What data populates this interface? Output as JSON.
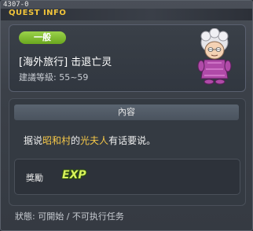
{
  "window": {
    "quest_id": "4307-0",
    "title": "QUEST INFO"
  },
  "quest": {
    "category_badge": "一般",
    "name": "[海外旅行] 击退亡灵",
    "level_requirement": "建議等級: 55~59"
  },
  "content": {
    "header": "內容",
    "text_prefix": "据说",
    "place": "昭和村",
    "text_mid": "的",
    "npc": "光夫人",
    "text_suffix": "有话要说。"
  },
  "reward": {
    "label": "獎勵",
    "exp_icon_text": "EXP"
  },
  "status": {
    "text": "狀態: 可開始 / 不可执行任务"
  },
  "colors": {
    "title": "#f2c53a",
    "badge": "#7fbf2f",
    "highlight": "#f6c848",
    "exp": "#d8f35a"
  },
  "icons": {
    "npc_portrait": "npc-old-lady-portrait-icon",
    "exp": "exp-icon"
  }
}
